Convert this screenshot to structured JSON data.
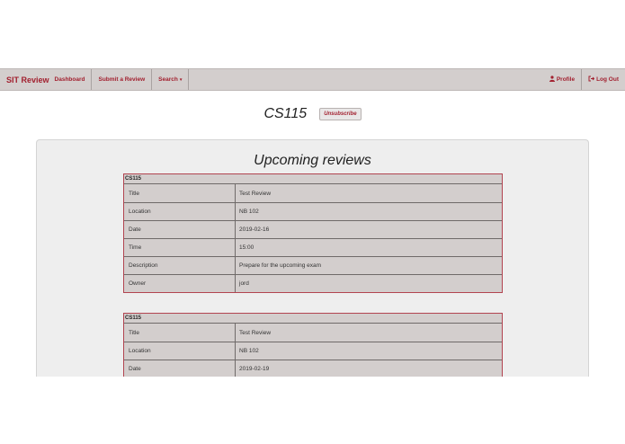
{
  "nav": {
    "brand": "SIT Review",
    "dashboard": "Dashboard",
    "submit_review": "Submit a Review",
    "search": "Search",
    "profile": "Profile",
    "logout": "Log Out"
  },
  "course": {
    "title": "CS115",
    "unsubscribe_label": "Unsubscribe"
  },
  "panel": {
    "title": "Upcoming reviews"
  },
  "reviews": [
    {
      "course": "CS115",
      "rows": [
        {
          "label": "Title",
          "value": "Test Review"
        },
        {
          "label": "Location",
          "value": "NB 102"
        },
        {
          "label": "Date",
          "value": "2019-02-16"
        },
        {
          "label": "Time",
          "value": "15:00"
        },
        {
          "label": "Description",
          "value": "Prepare for the upcoming exam"
        },
        {
          "label": "Owner",
          "value": "jord"
        }
      ]
    },
    {
      "course": "CS115",
      "rows": [
        {
          "label": "Title",
          "value": "Test Review"
        },
        {
          "label": "Location",
          "value": "NB 102"
        },
        {
          "label": "Date",
          "value": "2019-02-19"
        }
      ]
    }
  ],
  "colors": {
    "accent": "#a2202f",
    "navbar_bg": "#d3cecd",
    "panel_bg": "#eeeeee",
    "card_border": "#b24450"
  },
  "icons": {
    "profile": "user-icon",
    "logout": "logout-icon",
    "search_dropdown": "caret-down-icon"
  }
}
